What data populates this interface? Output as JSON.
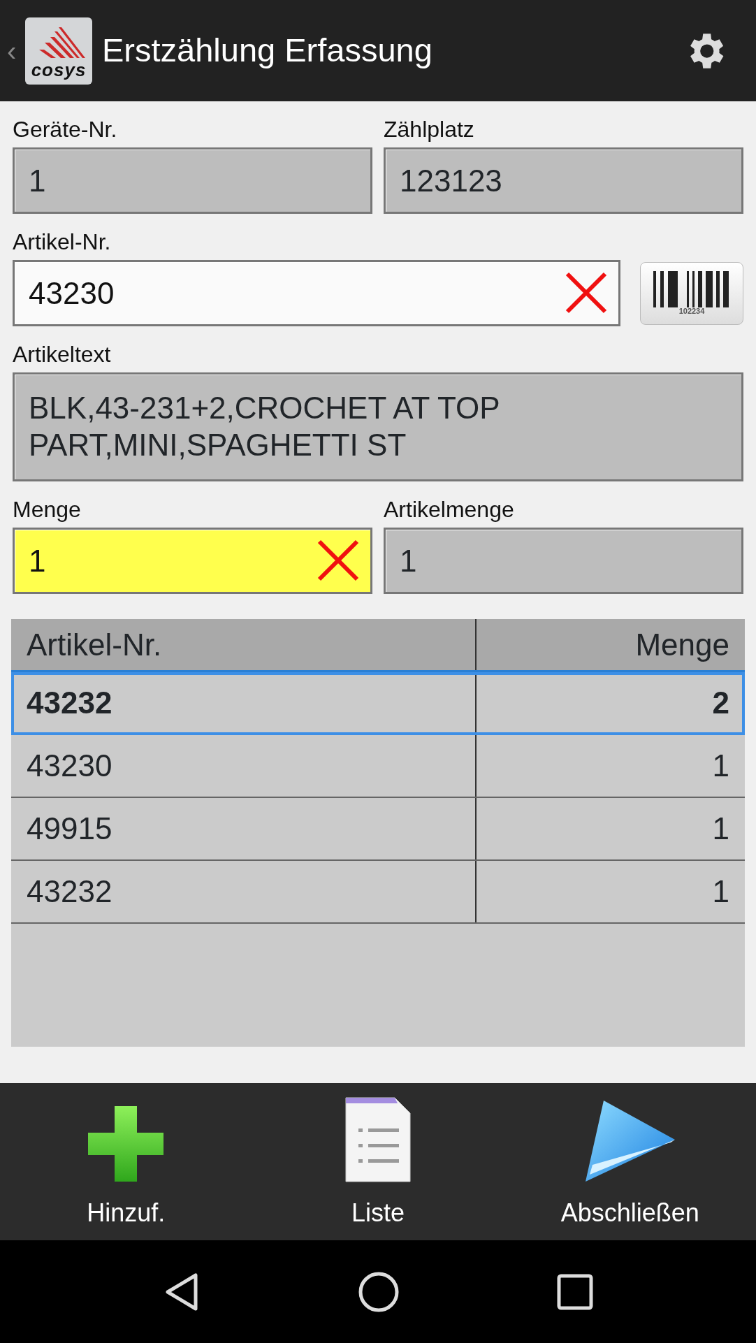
{
  "app_bar": {
    "back_glyph": "‹",
    "title": "Erstzählung Erfassung",
    "logo_text": "cosys"
  },
  "field_rows": [
    [
      {
        "label": "Geräte-Nr.",
        "value": "1",
        "editable": false,
        "focused": false
      },
      {
        "label": "Zählplatz",
        "value": "123123",
        "editable": false,
        "focused": false
      }
    ],
    [
      {
        "label": "Artikel-Nr.",
        "value": "43230",
        "editable": true,
        "focused": false,
        "barcode": "102234"
      }
    ],
    [
      {
        "label": "Artikeltext",
        "value": "BLK,43-231+2,CROCHET AT TOP PART,MINI,SPAGHETTI ST",
        "editable": false,
        "focused": false
      }
    ],
    [
      {
        "label": "Menge",
        "value": "1",
        "editable": true,
        "focused": true
      },
      {
        "label": "Artikelmenge",
        "value": "1",
        "editable": false,
        "focused": false
      }
    ]
  ],
  "table": {
    "columns": [
      "Artikel-Nr.",
      "Menge"
    ],
    "rows": [
      {
        "cells": [
          "43232",
          "2"
        ],
        "selected": true
      },
      {
        "cells": [
          "43230",
          "1"
        ],
        "selected": false
      },
      {
        "cells": [
          "49915",
          "1"
        ],
        "selected": false
      },
      {
        "cells": [
          "43232",
          "1"
        ],
        "selected": false
      }
    ]
  },
  "actions": [
    {
      "kind": "add",
      "label": "Hinzuf."
    },
    {
      "kind": "list",
      "label": "Liste"
    },
    {
      "kind": "finish",
      "label": "Abschließen"
    }
  ]
}
